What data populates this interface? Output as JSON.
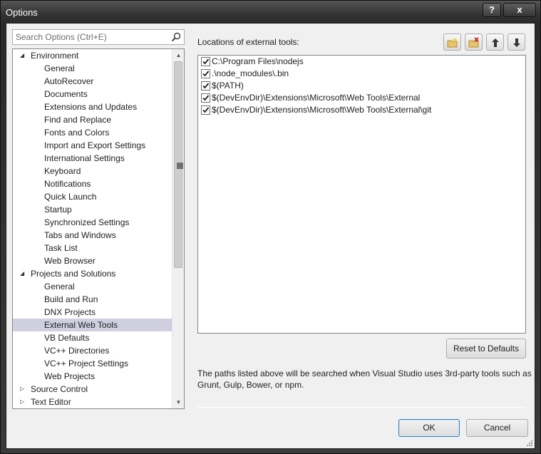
{
  "window": {
    "title": "Options",
    "help_label": "?",
    "close_label": "x"
  },
  "search": {
    "placeholder": "Search Options (Ctrl+E)",
    "value": ""
  },
  "tree": [
    {
      "label": "Environment",
      "level": 0,
      "expander": "expanded"
    },
    {
      "label": "General",
      "level": 1
    },
    {
      "label": "AutoRecover",
      "level": 1
    },
    {
      "label": "Documents",
      "level": 1
    },
    {
      "label": "Extensions and Updates",
      "level": 1
    },
    {
      "label": "Find and Replace",
      "level": 1
    },
    {
      "label": "Fonts and Colors",
      "level": 1
    },
    {
      "label": "Import and Export Settings",
      "level": 1
    },
    {
      "label": "International Settings",
      "level": 1
    },
    {
      "label": "Keyboard",
      "level": 1
    },
    {
      "label": "Notifications",
      "level": 1
    },
    {
      "label": "Quick Launch",
      "level": 1
    },
    {
      "label": "Startup",
      "level": 1
    },
    {
      "label": "Synchronized Settings",
      "level": 1
    },
    {
      "label": "Tabs and Windows",
      "level": 1
    },
    {
      "label": "Task List",
      "level": 1
    },
    {
      "label": "Web Browser",
      "level": 1
    },
    {
      "label": "Projects and Solutions",
      "level": 0,
      "expander": "expanded"
    },
    {
      "label": "General",
      "level": 1
    },
    {
      "label": "Build and Run",
      "level": 1
    },
    {
      "label": "DNX Projects",
      "level": 1
    },
    {
      "label": "External Web Tools",
      "level": 1,
      "selected": true
    },
    {
      "label": "VB Defaults",
      "level": 1
    },
    {
      "label": "VC++ Directories",
      "level": 1
    },
    {
      "label": "VC++ Project Settings",
      "level": 1
    },
    {
      "label": "Web Projects",
      "level": 1
    },
    {
      "label": "Source Control",
      "level": 0,
      "expander": "collapsed"
    },
    {
      "label": "Text Editor",
      "level": 0,
      "expander": "collapsed"
    }
  ],
  "main": {
    "locations_label": "Locations of external tools:",
    "paths": [
      {
        "text": "C:\\Program Files\\nodejs",
        "checked": true
      },
      {
        "text": ".\\node_modules\\.bin",
        "checked": true
      },
      {
        "text": "$(PATH)",
        "checked": true
      },
      {
        "text": "$(DevEnvDir)\\Extensions\\Microsoft\\Web Tools\\External",
        "checked": true
      },
      {
        "text": "$(DevEnvDir)\\Extensions\\Microsoft\\Web Tools\\External\\git",
        "checked": true
      }
    ],
    "toolbar": [
      {
        "name": "add-folder-button",
        "icon": "new-folder-icon"
      },
      {
        "name": "remove-folder-button",
        "icon": "delete-folder-icon"
      },
      {
        "name": "move-up-button",
        "icon": "arrow-up-icon"
      },
      {
        "name": "move-down-button",
        "icon": "arrow-down-icon"
      }
    ],
    "reset_label": "Reset to Defaults",
    "note": "The paths listed above will be searched when Visual Studio uses 3rd-party tools such as Grunt, Gulp, Bower, or npm."
  },
  "footer": {
    "ok_label": "OK",
    "cancel_label": "Cancel"
  },
  "colors": {
    "selection": "#cfcfdf",
    "titlebar": "#333333",
    "default_button_border": "#3c7fb1"
  }
}
